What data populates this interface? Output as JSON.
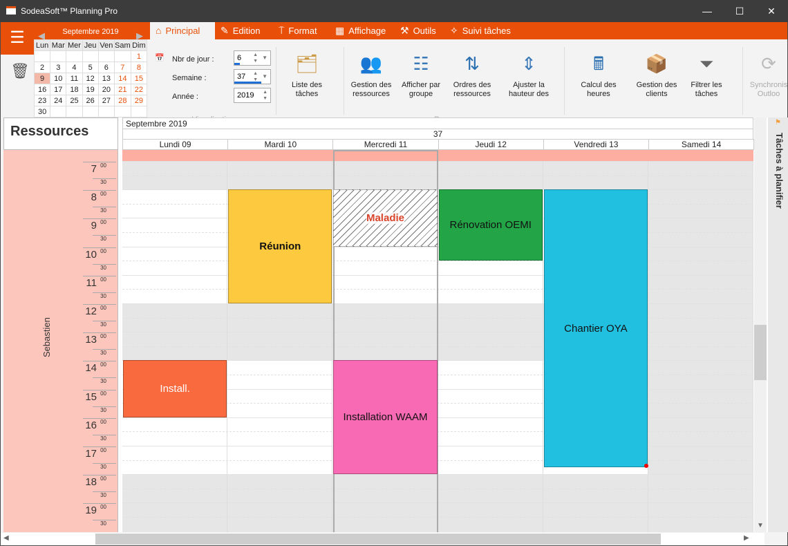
{
  "window": {
    "title": "SodeaSoft™ Planning Pro",
    "minimize": "—",
    "maximize": "☐",
    "close": "✕"
  },
  "colors": {
    "accent": "#e8500a",
    "resource": "#fdc6bc"
  },
  "minical": {
    "month": "Septembre 2019",
    "weekdays": [
      "Lun",
      "Mar",
      "Mer",
      "Jeu",
      "Ven",
      "Sam",
      "Dim"
    ],
    "weeks": [
      [
        "",
        "",
        "",
        "",
        "",
        "",
        "1"
      ],
      [
        "2",
        "3",
        "4",
        "5",
        "6",
        "7",
        "8"
      ],
      [
        "9",
        "10",
        "11",
        "12",
        "13",
        "14",
        "15"
      ],
      [
        "16",
        "17",
        "18",
        "19",
        "20",
        "21",
        "22"
      ],
      [
        "23",
        "24",
        "25",
        "26",
        "27",
        "28",
        "29"
      ],
      [
        "30",
        "",
        "",
        "",
        "",
        "",
        ""
      ]
    ],
    "selected": "9"
  },
  "tabs": [
    {
      "label": "Principal",
      "icon": "home-icon",
      "active": true
    },
    {
      "label": "Edition",
      "icon": "edit-icon"
    },
    {
      "label": "Format",
      "icon": "paint-roller-icon"
    },
    {
      "label": "Affichage",
      "icon": "grid-icon"
    },
    {
      "label": "Outils",
      "icon": "hammer-icon"
    },
    {
      "label": "Suivi tâches",
      "icon": "pin-icon"
    }
  ],
  "visualisation": {
    "group": "Visualisation",
    "nbr_label": "Nbr de jour :",
    "nbr_value": "6",
    "semaine_label": "Semaine :",
    "semaine_value": "37",
    "annee_label": "Année :",
    "annee_value": "2019"
  },
  "ribbon": {
    "ressources_group": "Ressources",
    "buttons": [
      {
        "label": "Liste des tâches",
        "icon": "task-list-icon"
      },
      {
        "label": "Gestion des ressources",
        "icon": "users-icon"
      },
      {
        "label": "Afficher par groupe",
        "icon": "group-icon"
      },
      {
        "label": "Ordres des ressources",
        "icon": "sort-users-icon"
      },
      {
        "label": "Ajuster la hauteur des",
        "icon": "resize-height-icon"
      },
      {
        "label": "Calcul des heures",
        "icon": "calculator-icon"
      },
      {
        "label": "Gestion des clients",
        "icon": "clients-icon"
      },
      {
        "label": "Filtrer les tâches",
        "icon": "filter-icon"
      },
      {
        "label": "Synchronis Outloo",
        "icon": "sync-icon"
      }
    ]
  },
  "planning": {
    "resources_title": "Ressources",
    "month": "Septembre 2019",
    "week": "37",
    "resource": "Sebastien",
    "days": [
      "Lundi 09",
      "Mardi 10",
      "Mercredi 11",
      "Jeudi 12",
      "Vendredi 13",
      "Samedi 14"
    ],
    "hours": [
      "7",
      "8",
      "9",
      "10",
      "11",
      "12",
      "13",
      "14",
      "15",
      "16",
      "17",
      "18",
      "19"
    ],
    "min0": "00",
    "min30": "30",
    "events": [
      {
        "title": "Réunion",
        "day": 1,
        "start": 8,
        "end": 12,
        "color": "#fdc93f",
        "bold": true
      },
      {
        "title": "Maladie",
        "day": 2,
        "start": 8,
        "end": 10,
        "color": "hatch",
        "text_color": "#d9452b",
        "bold": true
      },
      {
        "title": "Rénovation OEMI",
        "day": 3,
        "start": 8,
        "end": 10.5,
        "color": "#22a447"
      },
      {
        "title": "Chantier OYA",
        "day": 4,
        "start": 8,
        "end": 17.75,
        "color": "#22c0e0"
      },
      {
        "title": "Install.",
        "day": 0,
        "start": 14,
        "end": 16,
        "color": "#f96a3f",
        "text_color": "#ffffff"
      },
      {
        "title": "Installation WAAM",
        "day": 2,
        "start": 14,
        "end": 18,
        "color": "#f86ab4"
      }
    ]
  },
  "right_panel": {
    "label": "Tâches à planifier"
  }
}
